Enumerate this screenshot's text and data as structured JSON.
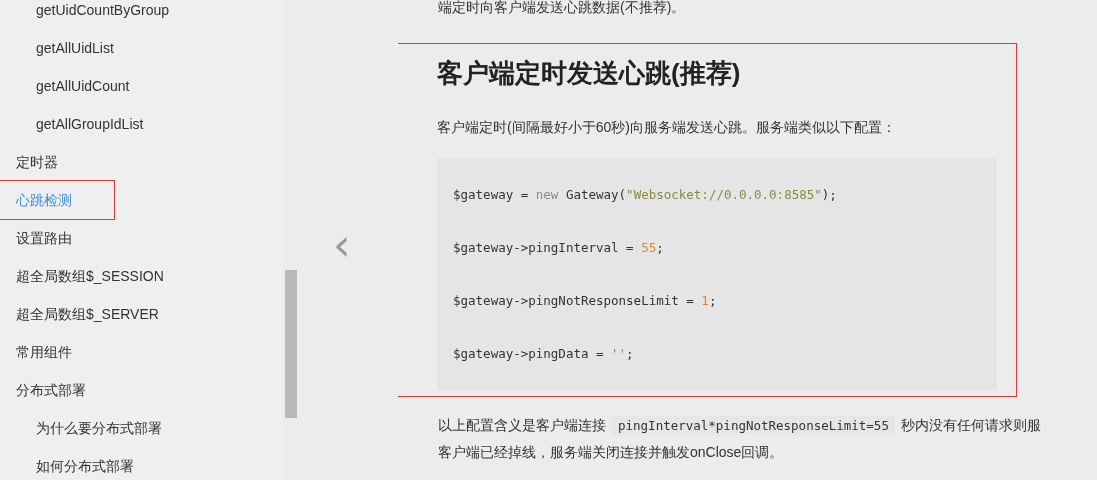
{
  "sidebar": {
    "sub_items_above": [
      {
        "label": "getUidCountByGroup",
        "selected": false,
        "annotated": false
      },
      {
        "label": "getAllUidList",
        "selected": false,
        "annotated": false
      },
      {
        "label": "getAllUidCount",
        "selected": false,
        "annotated": false
      },
      {
        "label": "getAllGroupIdList",
        "selected": false,
        "annotated": false
      }
    ],
    "items": [
      {
        "label": "定时器",
        "selected": false,
        "annotated": false
      },
      {
        "label": "心跳检测",
        "selected": true,
        "annotated": true
      },
      {
        "label": "设置路由",
        "selected": false,
        "annotated": false
      },
      {
        "label": "超全局数组$_SESSION",
        "selected": false,
        "annotated": false
      },
      {
        "label": "超全局数组$_SERVER",
        "selected": false,
        "annotated": false
      },
      {
        "label": "常用组件",
        "selected": false,
        "annotated": false
      },
      {
        "label": "分布式部署",
        "selected": false,
        "annotated": false,
        "children": [
          {
            "label": "为什么要分布式部署",
            "selected": false,
            "annotated": false
          },
          {
            "label": "如何分布式部署",
            "selected": false,
            "annotated": false
          }
        ]
      }
    ]
  },
  "prev_arrow": "‹",
  "article": {
    "intro": "端定时向客户端发送心跳数据(不推荐)。",
    "section": {
      "annotated": true,
      "heading": "客户端定时发送心跳(推荐)",
      "text": "客户端定时(间隔最好小于60秒)向服务端发送心跳。服务端类似以下配置：",
      "code_lines": [
        [
          {
            "kind": "plain",
            "text": "$gateway = "
          },
          {
            "kind": "keyword",
            "text": "new"
          },
          {
            "kind": "plain",
            "text": " Gateway("
          },
          {
            "kind": "string",
            "text": "\"Websocket://0.0.0.0:8585\""
          },
          {
            "kind": "plain",
            "text": ");"
          }
        ],
        [
          {
            "kind": "plain",
            "text": "$gateway->pingInterval = "
          },
          {
            "kind": "number",
            "text": "55"
          },
          {
            "kind": "plain",
            "text": ";"
          }
        ],
        [
          {
            "kind": "plain",
            "text": "$gateway->pingNotResponseLimit = "
          },
          {
            "kind": "number",
            "text": "1"
          },
          {
            "kind": "plain",
            "text": ";"
          }
        ],
        [
          {
            "kind": "plain",
            "text": "$gateway->pingData = "
          },
          {
            "kind": "string",
            "text": "''"
          },
          {
            "kind": "plain",
            "text": ";"
          }
        ]
      ]
    },
    "note_lines": [
      [
        {
          "kind": "text",
          "text": "以上配置含义是客户端连接"
        },
        {
          "kind": "code",
          "text": "pingInterval*pingNotResponseLimit=55"
        },
        {
          "kind": "text",
          "text": "秒内没有任何请求则服"
        }
      ],
      [
        {
          "kind": "text",
          "text": "客户端已经掉线，服务端关闭连接并触发onClose回调。"
        }
      ]
    ]
  }
}
